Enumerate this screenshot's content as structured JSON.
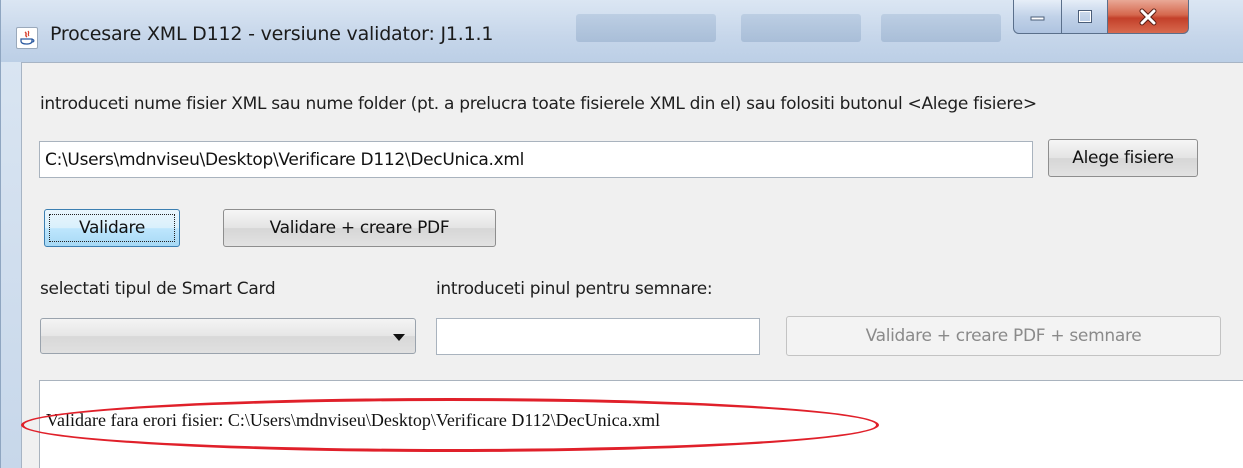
{
  "window": {
    "title": "Procesare XML D112 - versiune validator: J1.1.1",
    "controls": {
      "minimize_icon": "minimize-icon",
      "maximize_icon": "maximize-icon",
      "close_icon": "close-icon"
    }
  },
  "form": {
    "instruction": "introduceti nume fisier XML sau nume folder (pt. a prelucra toate fisierele XML din el) sau folositi butonul <Alege fisiere>",
    "file_path": "C:\\Users\\mdnviseu\\Desktop\\Verificare D112\\DecUnica.xml",
    "choose_files_label": "Alege fisiere",
    "validate_label": "Validare",
    "validate_pdf_label": "Validare + creare PDF",
    "smartcard_label": "selectati tipul de Smart Card",
    "smartcard_selected": "",
    "pin_label": "introduceti pinul pentru semnare:",
    "pin_value": "",
    "validate_pdf_sign_label": "Validare + creare PDF + semnare"
  },
  "output": {
    "message": "Validare fara erori fisier: C:\\Users\\mdnviseu\\Desktop\\Verificare D112\\DecUnica.xml"
  },
  "colors": {
    "highlight": "#e0202a",
    "focus_border": "#3c7fb1"
  }
}
